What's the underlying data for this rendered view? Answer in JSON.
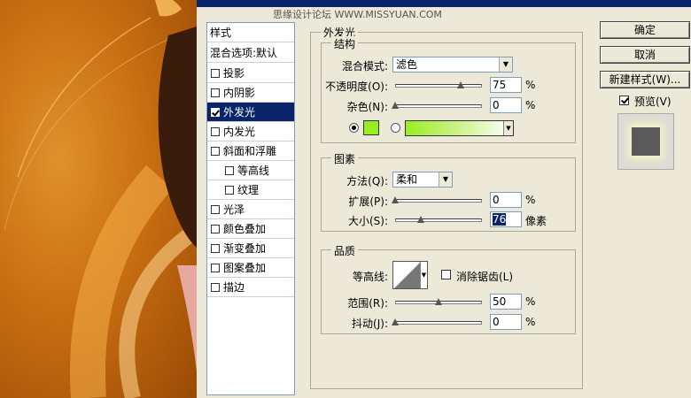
{
  "window": {
    "watermark": "思缘设计论坛 WWW.MISSYUAN.COM"
  },
  "styles_panel": {
    "header": "样式",
    "blend_options": "混合选项:默认",
    "items": [
      {
        "label": "投影",
        "checked": false
      },
      {
        "label": "内阴影",
        "checked": false
      },
      {
        "label": "外发光",
        "checked": true,
        "selected": true
      },
      {
        "label": "内发光",
        "checked": false
      },
      {
        "label": "斜面和浮雕",
        "checked": false
      },
      {
        "label": "等高线",
        "checked": false,
        "sub": true
      },
      {
        "label": "纹理",
        "checked": false,
        "sub": true
      },
      {
        "label": "光泽",
        "checked": false
      },
      {
        "label": "颜色叠加",
        "checked": false
      },
      {
        "label": "渐变叠加",
        "checked": false
      },
      {
        "label": "图案叠加",
        "checked": false
      },
      {
        "label": "描边",
        "checked": false
      }
    ]
  },
  "outer_glow": {
    "title": "外发光",
    "structure": {
      "title": "结构",
      "blend_mode_label": "混合模式:",
      "blend_mode_value": "滤色",
      "opacity_label": "不透明度(O):",
      "opacity_value": "75",
      "noise_label": "杂色(N):",
      "noise_value": "0",
      "percent": "%",
      "glow_color": "#99ee22",
      "opacity_fraction": 0.75,
      "noise_fraction": 0
    },
    "elements": {
      "title": "图素",
      "technique_label": "方法(Q):",
      "technique_value": "柔和",
      "spread_label": "扩展(P):",
      "spread_value": "0",
      "size_label": "大小(S):",
      "size_value": "76",
      "px_unit": "像素",
      "spread_fraction": 0,
      "size_fraction": 0.3
    },
    "quality": {
      "title": "品质",
      "contour_label": "等高线:",
      "antialias_label": "消除锯齿(L)",
      "range_label": "范围(R):",
      "range_value": "50",
      "jitter_label": "抖动(J):",
      "jitter_value": "0",
      "range_fraction": 0.5,
      "jitter_fraction": 0
    }
  },
  "buttons": {
    "ok": "确定",
    "cancel": "取消",
    "new_style": "新建样式(W)...",
    "preview_label": "预览(V)"
  }
}
